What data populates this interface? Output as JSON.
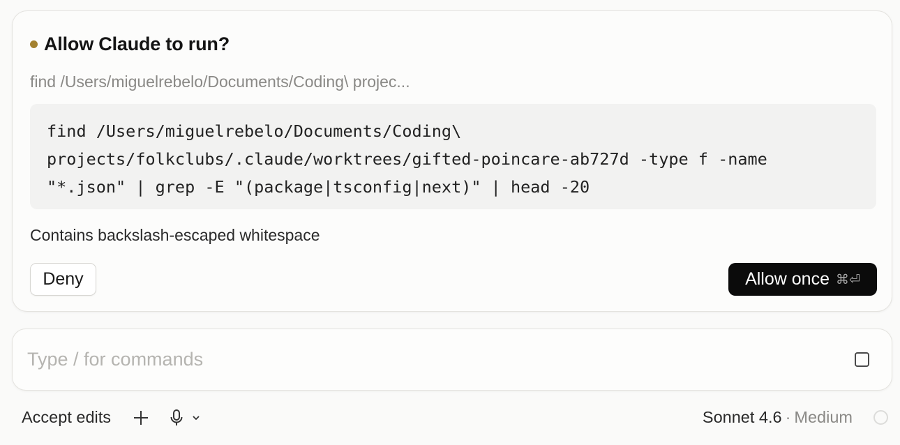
{
  "permission": {
    "title": "Allow Claude to run?",
    "summary": "find /Users/miguelrebelo/Documents/Coding\\ projec...",
    "command_lines": [
      "find /Users/miguelrebelo/Documents/Coding\\",
      "projects/folkclubs/.claude/worktrees/gifted-poincare-ab727d -type f -name",
      "\"*.json\" | grep -E \"(package|tsconfig|next)\" | head -20"
    ],
    "reason": "Contains backslash-escaped whitespace",
    "deny_label": "Deny",
    "allow_label": "Allow once",
    "allow_shortcut": "⌘⏎",
    "status_dot_color": "#a3812f"
  },
  "composer": {
    "placeholder": "Type / for commands",
    "accept_edits_label": "Accept edits",
    "model": "Sonnet 4.6",
    "separator": "·",
    "effort": "Medium",
    "icons": [
      "checkbox-icon",
      "plus-icon",
      "mic-icon",
      "chevron-down-icon",
      "status-circle-icon"
    ]
  }
}
